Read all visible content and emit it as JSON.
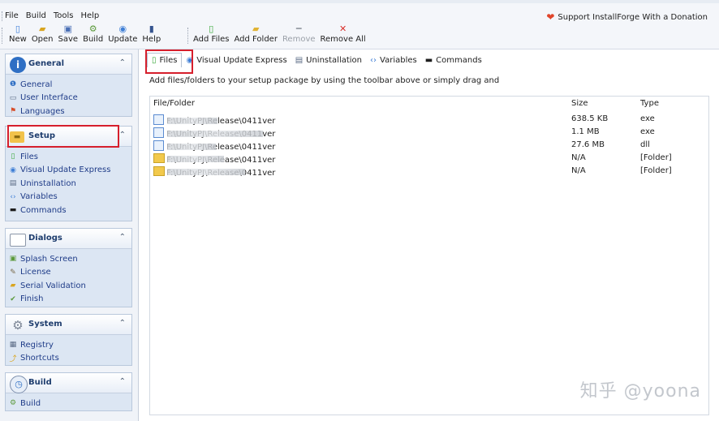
{
  "menu": [
    "File",
    "Build",
    "Tools",
    "Help"
  ],
  "donate": "Support InstallForge With a Donation",
  "toolbar": {
    "group1": [
      {
        "label": "New",
        "icon": "new-file-icon"
      },
      {
        "label": "Open",
        "icon": "open-icon"
      },
      {
        "label": "Save",
        "icon": "save-icon"
      },
      {
        "label": "Build",
        "icon": "build-icon"
      },
      {
        "label": "Update",
        "icon": "update-icon"
      },
      {
        "label": "Help",
        "icon": "help-book-icon"
      }
    ],
    "group2": [
      {
        "label": "Add Files",
        "icon": "add-files-icon",
        "enabled": true
      },
      {
        "label": "Add Folder",
        "icon": "add-folder-icon",
        "enabled": true
      },
      {
        "label": "Remove",
        "icon": "remove-icon",
        "enabled": false
      },
      {
        "label": "Remove All",
        "icon": "remove-all-icon",
        "enabled": true
      }
    ]
  },
  "sidebar": {
    "general": {
      "title": "General",
      "items": [
        "General",
        "User Interface",
        "Languages"
      ]
    },
    "setup": {
      "title": "Setup",
      "items": [
        "Files",
        "Visual Update Express",
        "Uninstallation",
        "Variables",
        "Commands"
      ]
    },
    "dialogs": {
      "title": "Dialogs",
      "items": [
        "Splash Screen",
        "License",
        "Serial Validation",
        "Finish"
      ]
    },
    "system": {
      "title": "System",
      "items": [
        "Registry",
        "Shortcuts"
      ]
    },
    "build": {
      "title": "Build",
      "items": [
        "Build"
      ]
    }
  },
  "tabs": [
    "Files",
    "Visual Update Express",
    "Uninstallation",
    "Variables",
    "Commands"
  ],
  "description": "Add files/folders to your setup package by using the toolbar above or simply drag and",
  "table": {
    "headers": [
      "File/Folder",
      "Size",
      "Type"
    ],
    "rows": [
      {
        "path": "F:\\UnityPJ\\Release\\0411ver",
        "size": "638.5 KB",
        "type": "exe",
        "kind": "file"
      },
      {
        "path": "F:\\UnityPJ\\Release\\0411ver",
        "size": "1.1 MB",
        "type": "exe",
        "kind": "file"
      },
      {
        "path": "F:\\UnityPJ\\Release\\0411ver",
        "size": "27.6 MB",
        "type": "dll",
        "kind": "file"
      },
      {
        "path": "F:\\UnityPJ\\Release\\0411ver",
        "size": "N/A",
        "type": "[Folder]",
        "kind": "folder"
      },
      {
        "path": "F:\\UnityPJ\\Release\\0411ver",
        "size": "N/A",
        "type": "[Folder]",
        "kind": "folder"
      }
    ]
  },
  "watermark": "知乎 @yoona",
  "colors": {
    "highlight": "#d61f2c",
    "link": "#1f3c88",
    "panel": "#dce6f3"
  }
}
